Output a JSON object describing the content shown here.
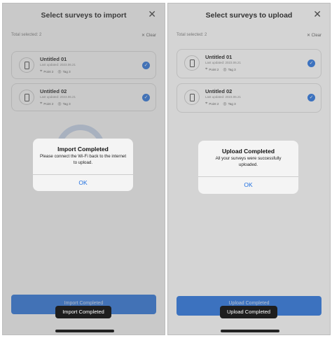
{
  "import_screen": {
    "title": "Select surveys to import",
    "close_glyph": "✕",
    "selection": {
      "total": "Total selected: 2",
      "clear": "✕ Clear"
    },
    "surveys": [
      {
        "name": "Untitled 01",
        "updated": "Last updated: 2023.06.21",
        "points": "Point 2",
        "tags": "Tag 3",
        "checked": true
      },
      {
        "name": "Untitled 02",
        "updated": "Last updated: 2023.06.21",
        "points": "Point 2",
        "tags": "Tag 3",
        "checked": true
      }
    ],
    "alert": {
      "title": "Import Completed",
      "message": "Please connect the Wi-Fi back to the internet to upload.",
      "ok": "OK"
    },
    "primary_button": {
      "label": "Import Completed"
    },
    "toast": "Import Completed"
  },
  "upload_screen": {
    "title": "Select surveys to upload",
    "close_glyph": "✕",
    "selection": {
      "total": "Total selected: 2",
      "clear": "✕ Clear"
    },
    "surveys": [
      {
        "name": "Untitled 01",
        "updated": "Last updated: 2023.06.21",
        "points": "Point 2",
        "tags": "Tag 3",
        "checked": true
      },
      {
        "name": "Untitled 02",
        "updated": "Last updated: 2023.06.21",
        "points": "Point 2",
        "tags": "Tag 3",
        "checked": true
      }
    ],
    "alert": {
      "title": "Upload Completed",
      "message": "All your surveys were successfully uploaded.",
      "ok": "OK"
    },
    "primary_button": {
      "label": "Upload Completed"
    },
    "toast": "Upload Completed"
  },
  "icons": {
    "device": "device-icon",
    "point": "point-icon",
    "tag": "tag-icon",
    "check": "✓"
  },
  "colors": {
    "accent": "#1f6fe0",
    "dim_overlay": "rgba(120,120,120,0.4)",
    "toast_bg": "#1e1e1e"
  }
}
